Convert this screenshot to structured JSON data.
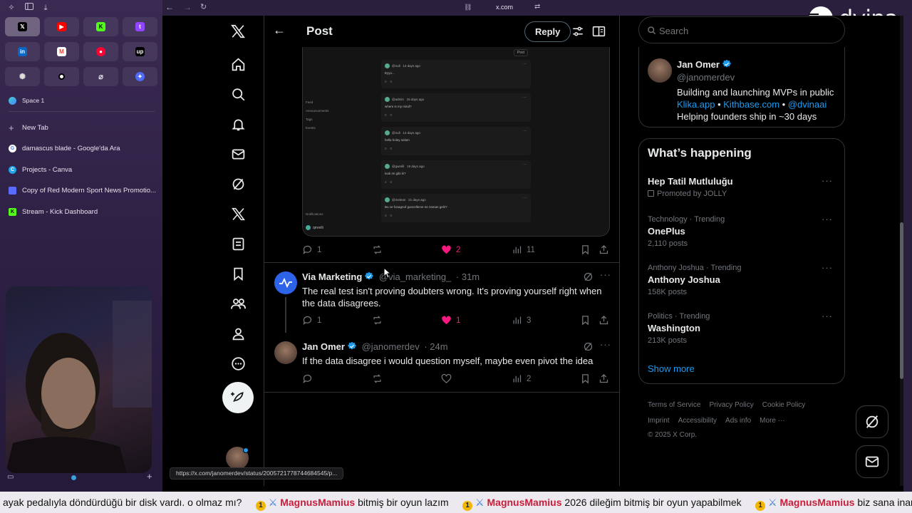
{
  "browser": {
    "url": "x.com",
    "space_label": "Space 1",
    "new_tab_label": "New Tab",
    "tabs": [
      {
        "label": "damascus blade - Google'da Ara",
        "color": "#ffffff"
      },
      {
        "label": "Projects - Canva",
        "color": "#1fa5e6"
      },
      {
        "label": "Copy of Red Modern Sport News Promotio...",
        "color": "#5a6bff"
      },
      {
        "label": "Stream - Kick Dashboard",
        "color": "#53fc18"
      }
    ],
    "pinned": [
      "x-favicon",
      "youtube-favicon",
      "kick-favicon",
      "twitch-favicon",
      "linkedin-favicon",
      "gmail-favicon",
      "youtube-music-favicon",
      "upwork-favicon",
      "chatgpt-favicon",
      "dot-favicon",
      "perplexity-favicon",
      "gemini-favicon"
    ],
    "status_url": "https://x.com/janomerdev/status/2005721778744684545/p..."
  },
  "overlay": {
    "brand": "dvina"
  },
  "header": {
    "title": "Post",
    "reply_label": "Reply"
  },
  "post": {
    "stats": {
      "replies": "1",
      "likes": "2",
      "views": "11"
    }
  },
  "screenshot_mock": {
    "post_btn": "Post",
    "menu": [
      "Feed",
      "Announcements",
      "Tags",
      "Events"
    ],
    "footer": [
      "Notifications",
      "qmrelli"
    ],
    "comments": [
      {
        "user": "@null",
        "time": "13 days ago",
        "text": "Eyyo...",
        "counts": [
          "0",
          "0"
        ]
      },
      {
        "user": "@admin",
        "time": "15 days ago",
        "text": "where is my mind?",
        "counts": [
          "0",
          "0"
        ]
      },
      {
        "user": "@null",
        "time": "13 days ago",
        "text": "hella holey selam",
        "counts": [
          "0",
          "0"
        ]
      },
      {
        "user": "@gwrelli",
        "time": "19 days ago",
        "text": "look mi gibi ki?",
        "counts": [
          "4",
          "0"
        ]
      },
      {
        "user": "@melean",
        "time": "21 days ago",
        "text": "Bu ve fonagnof guncelleme ne zaman gelir?",
        "counts": [
          "3",
          "0"
        ]
      }
    ]
  },
  "replies": [
    {
      "name": "Via Marketing",
      "handle": "@via_marketing_",
      "time": "· 31m",
      "text": "The real test isn't proving doubters wrong. It's proving yourself right when the data disagrees.",
      "stats": {
        "replies": "1",
        "likes": "1",
        "views": "3"
      }
    },
    {
      "name": "Jan Omer",
      "handle": "@janomerdev",
      "time": "· 24m",
      "text": "If the data disagree i would question myself, maybe even pivot the idea",
      "stats": {
        "replies": "",
        "likes": "",
        "views": "2"
      }
    }
  ],
  "search": {
    "placeholder": "Search"
  },
  "profile": {
    "name": "Jan Omer",
    "handle": "@janomerdev",
    "bio": "Building and launching MVPs in public",
    "links": [
      "Klika.app",
      "Kithbase.com",
      "@dvinaai"
    ],
    "bio2": "Helping founders ship in ~30 days"
  },
  "trends": {
    "title": "What’s happening",
    "items": [
      {
        "meta": "",
        "title": "Hep Tatil Mutluluğu",
        "sub": "Promoted by JOLLY"
      },
      {
        "meta": "Technology · Trending",
        "title": "OnePlus",
        "sub": "2,110 posts"
      },
      {
        "meta": "Anthony Joshua · Trending",
        "title": "Anthony Joshua",
        "sub": "158K posts"
      },
      {
        "meta": "Politics · Trending",
        "title": "Washington",
        "sub": "213K posts"
      }
    ],
    "show_more": "Show more"
  },
  "footer": {
    "links": [
      "Terms of Service",
      "Privacy Policy",
      "Cookie Policy",
      "Imprint",
      "Accessibility",
      "Ads info",
      "More ···"
    ],
    "copyright": "© 2025 X Corp."
  },
  "ticker": {
    "lead": "ayak pedalıyla döndürdüğü bir disk vardı. o olmaz mı?",
    "messages": [
      {
        "user": "MagnusMamius",
        "text": "bitmiş bir oyun lazım"
      },
      {
        "user": "MagnusMamius",
        "text": "2026 dileğim bitmiş bir oyun yapabilmek"
      },
      {
        "user": "MagnusMamius",
        "text": "biz sana inanıyoruz abi"
      }
    ]
  },
  "colors": {
    "accent": "#1d9bf0",
    "like": "#f91880",
    "verified": "#1d9bf0"
  }
}
